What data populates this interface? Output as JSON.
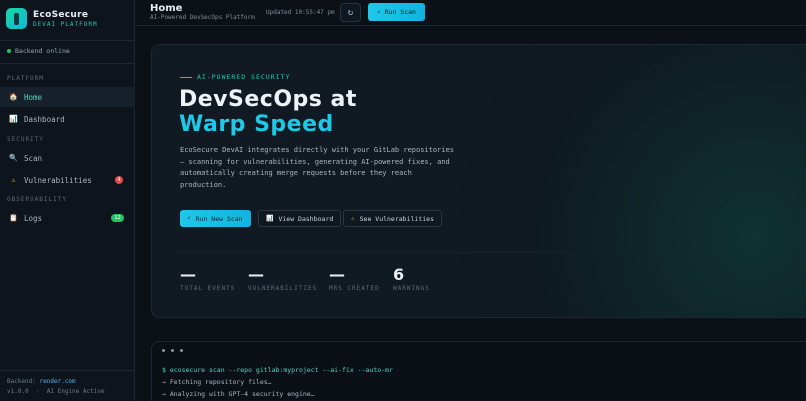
{
  "brand": {
    "name": "EcoSecure",
    "subtitle": "DEVAI PLATFORM"
  },
  "sidebar": {
    "backend_status": "Backend online",
    "sections": [
      {
        "label": "PLATFORM"
      },
      {
        "label": "SECURITY"
      },
      {
        "label": "OBSERVABILITY"
      }
    ],
    "items": [
      {
        "label": "Home",
        "icon": "house-icon",
        "glyph": "🏠",
        "active": true
      },
      {
        "label": "Dashboard",
        "icon": "chart-icon",
        "glyph": "📊"
      },
      {
        "label": "Scan",
        "icon": "magnifier-icon",
        "glyph": "🔍"
      },
      {
        "label": "Vulnerabilities",
        "icon": "warning-icon",
        "glyph": "⚠",
        "badge": "4"
      },
      {
        "label": "Logs",
        "icon": "clipboard-icon",
        "glyph": "📋",
        "badge": "12"
      }
    ],
    "footer": {
      "backend_prefix": "Backend:",
      "backend_host": "render.com",
      "version": "v1.0.0",
      "engine": "AI Engine Active"
    }
  },
  "header": {
    "title": "Home",
    "subtitle": "AI-Powered DevSecOps Platform",
    "updated": "Updated 10:55:47 pm",
    "refresh_glyph": "↻",
    "run_scan_label": "Run Scan",
    "run_scan_glyph": "⚡"
  },
  "hero": {
    "eyebrow": "AI-POWERED SECURITY",
    "title_line1": "DevSecOps at",
    "title_line2": "Warp Speed",
    "description": "EcoSecure DevAI integrates directly with your GitLab repositories — scanning for vulnerabilities, generating AI-powered fixes, and automatically creating merge requests before they reach production.",
    "buttons": [
      {
        "label": "Run New Scan",
        "glyph": "⚡"
      },
      {
        "label": "View Dashboard",
        "glyph": "📊"
      },
      {
        "label": "See Vulnerabilities",
        "glyph": "⚠"
      }
    ],
    "stats": [
      {
        "value": "—",
        "label": "TOTAL EVENTS"
      },
      {
        "value": "—",
        "label": "VULNERABILITIES"
      },
      {
        "value": "—",
        "label": "MRS CREATED"
      },
      {
        "value": "6",
        "label": "WARNINGS"
      }
    ]
  },
  "terminal": {
    "lines": [
      "$ ecosecure scan --repo gitlab:myproject --ai-fix --auto-mr",
      "→ Fetching repository files…",
      "→ Analyzing with GPT-4 security engine…"
    ]
  },
  "colors": {
    "accent": "#1ec8e8",
    "teal": "#19c9b4",
    "danger": "#e5484d",
    "success": "#22c55e"
  }
}
